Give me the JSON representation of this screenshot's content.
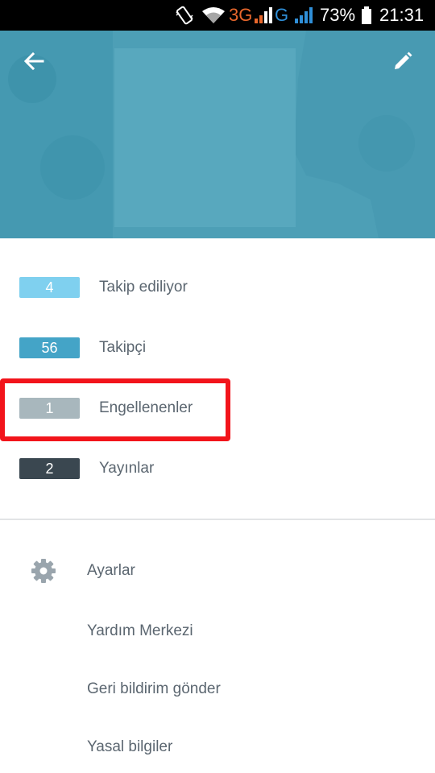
{
  "status_bar": {
    "network_3g": "3G",
    "network_g": "G",
    "battery_percent": "73%",
    "time": "21:31",
    "icons": [
      "phone-vibrate-icon",
      "wifi-icon",
      "signal-icon",
      "battery-icon"
    ],
    "colors": {
      "network_3g": "#e8672c",
      "network_g": "#2f8fd8"
    }
  },
  "header": {
    "back_icon": "arrow-left-icon",
    "edit_icon": "pencil-icon",
    "background_color": "#4d9fb6"
  },
  "stats": [
    {
      "count": "4",
      "label": "Takip ediliyor",
      "color": "#7fd0ef"
    },
    {
      "count": "56",
      "label": "Takipçi",
      "color": "#44a4c7"
    },
    {
      "count": "1",
      "label": "Engellenenler",
      "color": "#a8b7bd",
      "highlighted": true
    },
    {
      "count": "2",
      "label": "Yayınlar",
      "color": "#3a4750"
    }
  ],
  "menu": [
    {
      "label": "Ayarlar",
      "icon": "gear-icon"
    },
    {
      "label": "Yardım Merkezi"
    },
    {
      "label": "Geri bildirim gönder"
    },
    {
      "label": "Yasal bilgiler"
    }
  ],
  "highlight_color": "#f2141b"
}
